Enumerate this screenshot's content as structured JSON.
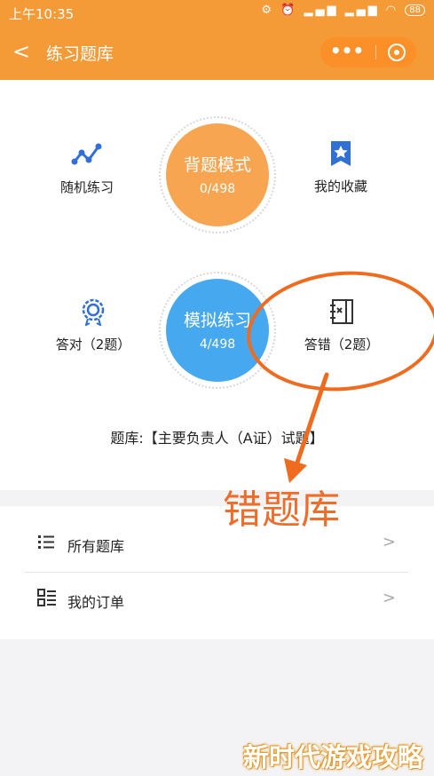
{
  "status_bar": {
    "time": "上午10:35",
    "indicators": "⚙ ⏰ ▂▄▆ ▂▄▆ ◠",
    "battery": "88"
  },
  "nav": {
    "back_icon": "chevron-left-icon",
    "back_glyph": "<",
    "title": "练习题库",
    "more_glyph": "•••",
    "accent_color": "#f49a36"
  },
  "modes": {
    "recite": {
      "label": "背题模式",
      "count": "0/498",
      "color": "#f7a551"
    },
    "mock": {
      "label": "模拟练习",
      "count": "4/498",
      "color": "#46a9f0"
    }
  },
  "shortcuts": {
    "random": "随机练习",
    "favorites": "我的收藏",
    "correct": "答对（2题）",
    "wrong": "答错（2题）"
  },
  "bank_title": "题库:【主要负责人（A证）试题】",
  "menu": [
    {
      "label": "所有题库",
      "icon": "list-icon",
      "arrow": ">"
    },
    {
      "label": "我的订单",
      "icon": "order-list-icon",
      "arrow": ">"
    }
  ],
  "annotation": {
    "text": "错题库",
    "color": "#ee6d2b"
  },
  "watermark": "新时代游戏攻略"
}
